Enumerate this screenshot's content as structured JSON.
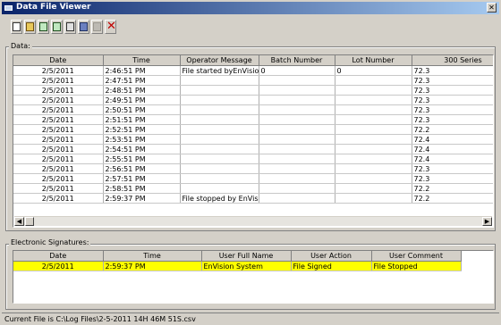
{
  "window": {
    "title": "Data File Viewer",
    "close_glyph": "✕"
  },
  "toolbar": [
    {
      "name": "new-document-icon",
      "cls": "ic-doc"
    },
    {
      "name": "open-folder-icon",
      "cls": "ic-open"
    },
    {
      "name": "copy-icon",
      "cls": "ic-copy"
    },
    {
      "name": "paste-icon",
      "cls": "ic-copy"
    },
    {
      "name": "print-icon",
      "cls": "ic-print"
    },
    {
      "name": "save-disk-icon",
      "cls": "ic-disk"
    },
    {
      "name": "disabled-icon",
      "cls": "ic-gray"
    },
    {
      "name": "delete-icon",
      "cls": "ic-x",
      "glyph": "✕"
    }
  ],
  "data_group": {
    "label": "Data:",
    "columns": [
      "Date",
      "Time",
      "Operator Message",
      "Batch Number",
      "Lot Number",
      "300 Series"
    ],
    "rows": [
      [
        "2/5/2011",
        "2:46:51 PM",
        "File started byEnVision",
        "0",
        "0",
        "72.3"
      ],
      [
        "2/5/2011",
        "2:47:51 PM",
        "",
        "",
        "",
        "72.3"
      ],
      [
        "2/5/2011",
        "2:48:51 PM",
        "",
        "",
        "",
        "72.3"
      ],
      [
        "2/5/2011",
        "2:49:51 PM",
        "",
        "",
        "",
        "72.3"
      ],
      [
        "2/5/2011",
        "2:50:51 PM",
        "",
        "",
        "",
        "72.3"
      ],
      [
        "2/5/2011",
        "2:51:51 PM",
        "",
        "",
        "",
        "72.3"
      ],
      [
        "2/5/2011",
        "2:52:51 PM",
        "",
        "",
        "",
        "72.2"
      ],
      [
        "2/5/2011",
        "2:53:51 PM",
        "",
        "",
        "",
        "72.4"
      ],
      [
        "2/5/2011",
        "2:54:51 PM",
        "",
        "",
        "",
        "72.4"
      ],
      [
        "2/5/2011",
        "2:55:51 PM",
        "",
        "",
        "",
        "72.4"
      ],
      [
        "2/5/2011",
        "2:56:51 PM",
        "",
        "",
        "",
        "72.3"
      ],
      [
        "2/5/2011",
        "2:57:51 PM",
        "",
        "",
        "",
        "72.3"
      ],
      [
        "2/5/2011",
        "2:58:51 PM",
        "",
        "",
        "",
        "72.2"
      ],
      [
        "2/5/2011",
        "2:59:37 PM",
        "File stopped by EnVisio",
        "",
        "",
        "72.2"
      ]
    ]
  },
  "signatures_group": {
    "label": "Electronic Signatures:",
    "columns": [
      "Date",
      "Time",
      "User Full Name",
      "User Action",
      "User Comment"
    ],
    "rows": [
      [
        "2/5/2011",
        "2:59:37 PM",
        "EnVision System",
        "File Signed",
        "File Stopped"
      ]
    ]
  },
  "status": {
    "text": "Current File is C:\\Log Files\\2-5-2011  14H  46M  51S.csv"
  },
  "colors": {
    "title_start": "#0a246a",
    "title_end": "#a6caf0",
    "highlight": "#ffff00"
  },
  "scroll": {
    "left_glyph": "◀",
    "right_glyph": "▶"
  }
}
